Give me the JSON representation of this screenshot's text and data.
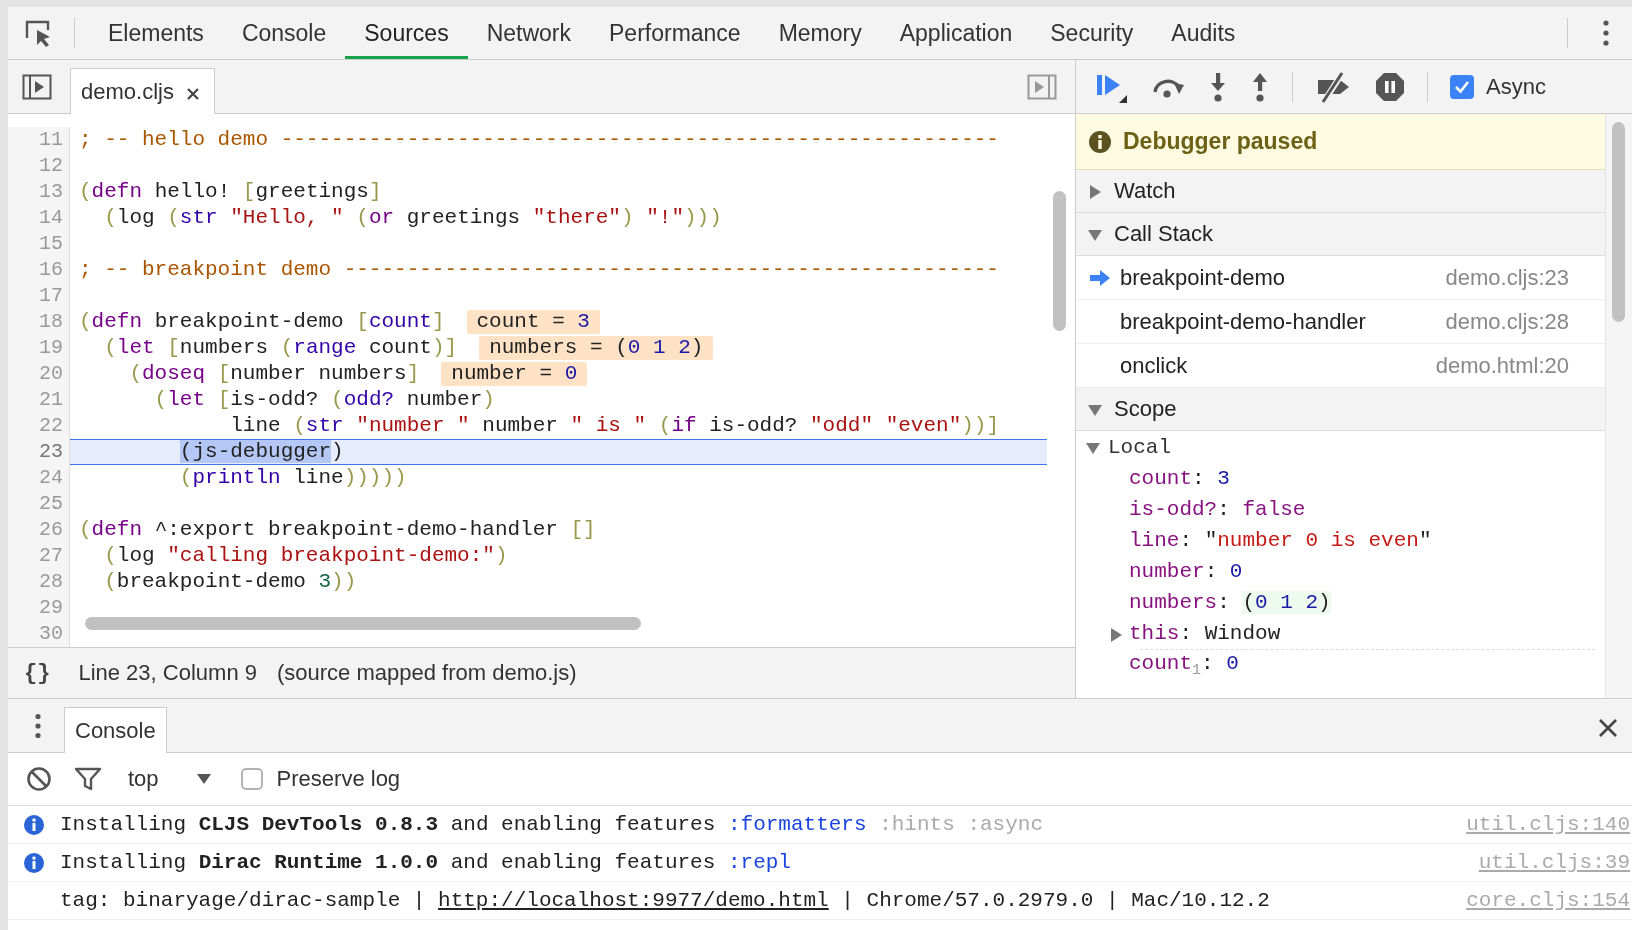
{
  "tabs": [
    {
      "label": "Elements",
      "selected": false
    },
    {
      "label": "Console",
      "selected": false
    },
    {
      "label": "Sources",
      "selected": true
    },
    {
      "label": "Network",
      "selected": false
    },
    {
      "label": "Performance",
      "selected": false
    },
    {
      "label": "Memory",
      "selected": false
    },
    {
      "label": "Application",
      "selected": false
    },
    {
      "label": "Security",
      "selected": false
    },
    {
      "label": "Audits",
      "selected": false
    }
  ],
  "editor": {
    "file_tab": {
      "label": "demo.cljs",
      "selected": true
    },
    "lines": [
      {
        "number": "11",
        "current": false,
        "code": [
          {
            "kind": "comment",
            "text": "; -- hello demo ---------------------------------------------------------"
          }
        ]
      },
      {
        "number": "12",
        "current": false
      },
      {
        "number": "13",
        "current": false,
        "code": [
          {
            "kind": "paren",
            "text": "("
          },
          {
            "kind": "keyword",
            "text": "defn"
          },
          {
            "kind": "plain",
            "text": " hello! "
          },
          {
            "kind": "paren",
            "text": "["
          },
          {
            "kind": "plain",
            "text": "greetings"
          },
          {
            "kind": "paren",
            "text": "]"
          }
        ]
      },
      {
        "number": "14",
        "current": false,
        "code": [
          {
            "kind": "paren",
            "text": "  ("
          },
          {
            "kind": "plain",
            "text": "log "
          },
          {
            "kind": "paren",
            "text": "("
          },
          {
            "kind": "builtin",
            "text": "str"
          },
          {
            "kind": "string",
            "text": " \"Hello, \""
          },
          {
            "kind": "paren",
            "text": " ("
          },
          {
            "kind": "keyword",
            "text": "or"
          },
          {
            "kind": "plain",
            "text": " greetings "
          },
          {
            "kind": "string",
            "text": "\"there\""
          },
          {
            "kind": "paren",
            "text": ")"
          },
          {
            "kind": "string",
            "text": " \"!\""
          },
          {
            "kind": "paren",
            "text": ")))"
          }
        ]
      },
      {
        "number": "15",
        "current": false
      },
      {
        "number": "16",
        "current": false,
        "code": [
          {
            "kind": "comment",
            "text": "; -- breakpoint demo ----------------------------------------------------"
          }
        ]
      },
      {
        "number": "17",
        "current": false
      },
      {
        "number": "18",
        "current": false,
        "code": [
          {
            "kind": "paren",
            "text": "("
          },
          {
            "kind": "keyword",
            "text": "defn"
          },
          {
            "kind": "plain",
            "text": " breakpoint-demo "
          },
          {
            "kind": "paren",
            "text": "["
          },
          {
            "kind": "builtin",
            "text": "count"
          },
          {
            "kind": "paren",
            "text": "]"
          }
        ],
        "inline_value": [
          {
            "kind": "plain",
            "text": "count = "
          },
          {
            "kind": "value",
            "text": "3"
          }
        ]
      },
      {
        "number": "19",
        "current": false,
        "code": [
          {
            "kind": "paren",
            "text": "  ("
          },
          {
            "kind": "keyword",
            "text": "let"
          },
          {
            "kind": "paren",
            "text": " ["
          },
          {
            "kind": "plain",
            "text": "numbers "
          },
          {
            "kind": "paren",
            "text": "("
          },
          {
            "kind": "builtin",
            "text": "range"
          },
          {
            "kind": "plain",
            "text": " count"
          },
          {
            "kind": "paren",
            "text": ")]"
          }
        ],
        "inline_value": [
          {
            "kind": "plain",
            "text": "numbers = ("
          },
          {
            "kind": "value",
            "text": "0 1 2"
          },
          {
            "kind": "plain",
            "text": ")"
          }
        ]
      },
      {
        "number": "20",
        "current": false,
        "code": [
          {
            "kind": "paren",
            "text": "    ("
          },
          {
            "kind": "keyword",
            "text": "doseq"
          },
          {
            "kind": "paren",
            "text": " ["
          },
          {
            "kind": "plain",
            "text": "number numbers"
          },
          {
            "kind": "paren",
            "text": "]"
          }
        ],
        "inline_value": [
          {
            "kind": "plain",
            "text": "number = "
          },
          {
            "kind": "value",
            "text": "0"
          }
        ]
      },
      {
        "number": "21",
        "current": false,
        "code": [
          {
            "kind": "paren",
            "text": "      ("
          },
          {
            "kind": "keyword",
            "text": "let"
          },
          {
            "kind": "paren",
            "text": " ["
          },
          {
            "kind": "plain",
            "text": "is-odd? "
          },
          {
            "kind": "paren",
            "text": "("
          },
          {
            "kind": "builtin",
            "text": "odd?"
          },
          {
            "kind": "plain",
            "text": " number"
          },
          {
            "kind": "paren",
            "text": ")"
          }
        ]
      },
      {
        "number": "22",
        "current": false,
        "code": [
          {
            "kind": "plain",
            "text": "            line "
          },
          {
            "kind": "paren",
            "text": "("
          },
          {
            "kind": "builtin",
            "text": "str"
          },
          {
            "kind": "string",
            "text": " \"number \""
          },
          {
            "kind": "plain",
            "text": " number "
          },
          {
            "kind": "string",
            "text": "\" is \""
          },
          {
            "kind": "paren",
            "text": " ("
          },
          {
            "kind": "keyword",
            "text": "if"
          },
          {
            "kind": "plain",
            "text": " is-odd? "
          },
          {
            "kind": "string",
            "text": "\"odd\""
          },
          {
            "kind": "string",
            "text": " \"even\""
          },
          {
            "kind": "paren",
            "text": "))]"
          }
        ]
      },
      {
        "number": "23",
        "current": true,
        "code": [
          {
            "kind": "selection",
            "text": "        (js-debugger"
          },
          {
            "kind": "plain",
            "text": ")"
          }
        ]
      },
      {
        "number": "24",
        "current": false,
        "code": [
          {
            "kind": "paren",
            "text": "        ("
          },
          {
            "kind": "builtin",
            "text": "println"
          },
          {
            "kind": "plain",
            "text": " line"
          },
          {
            "kind": "paren",
            "text": ")))))"
          }
        ]
      },
      {
        "number": "25",
        "current": false
      },
      {
        "number": "26",
        "current": false,
        "code": [
          {
            "kind": "paren",
            "text": "("
          },
          {
            "kind": "keyword",
            "text": "defn"
          },
          {
            "kind": "plain",
            "text": " ^:export breakpoint-demo-handler "
          },
          {
            "kind": "paren",
            "text": "[]"
          }
        ]
      },
      {
        "number": "27",
        "current": false,
        "code": [
          {
            "kind": "paren",
            "text": "  ("
          },
          {
            "kind": "plain",
            "text": "log "
          },
          {
            "kind": "string",
            "text": "\"calling breakpoint-demo:\""
          },
          {
            "kind": "paren",
            "text": ")"
          }
        ]
      },
      {
        "number": "28",
        "current": false,
        "code": [
          {
            "kind": "paren",
            "text": "  ("
          },
          {
            "kind": "plain",
            "text": "breakpoint-demo "
          },
          {
            "kind": "number",
            "text": "3"
          },
          {
            "kind": "paren",
            "text": "))"
          }
        ]
      },
      {
        "number": "29",
        "current": false
      },
      {
        "number": "30",
        "current": false
      }
    ]
  },
  "status_bar": {
    "format_button": "{}",
    "position": "Line 23, Column 9",
    "source_map": "(source mapped from demo.js)"
  },
  "debugger": {
    "async": {
      "label": "Async",
      "checked": true
    },
    "banner": "Debugger paused",
    "watch": {
      "label": "Watch",
      "expanded": false
    },
    "call_stack": {
      "label": "Call Stack",
      "expanded": true,
      "frames": [
        {
          "name": "breakpoint-demo",
          "location": "demo.cljs:23",
          "selected": true
        },
        {
          "name": "breakpoint-demo-handler",
          "location": "demo.cljs:28",
          "selected": false
        },
        {
          "name": "onclick",
          "location": "demo.html:20",
          "selected": false
        }
      ]
    },
    "scope": {
      "label": "Scope",
      "expanded": true,
      "local": {
        "label": "Local",
        "expanded": true,
        "groups": [
          [
            {
              "expandable": false,
              "segments": [
                {
                  "kind": "name",
                  "text": "count"
                },
                {
                  "kind": "punct",
                  "text": ": "
                },
                {
                  "kind": "number",
                  "text": "3"
                }
              ]
            },
            {
              "expandable": false,
              "segments": [
                {
                  "kind": "name",
                  "text": "is-odd?"
                },
                {
                  "kind": "punct",
                  "text": ": "
                },
                {
                  "kind": "boolean",
                  "text": "false"
                }
              ]
            },
            {
              "expandable": false,
              "segments": [
                {
                  "kind": "name",
                  "text": "line"
                },
                {
                  "kind": "punct",
                  "text": ": \""
                },
                {
                  "kind": "string",
                  "text": "number 0 is even"
                },
                {
                  "kind": "punct",
                  "text": "\""
                }
              ]
            },
            {
              "expandable": false,
              "segments": [
                {
                  "kind": "name",
                  "text": "number"
                },
                {
                  "kind": "punct",
                  "text": ": "
                },
                {
                  "kind": "number",
                  "text": "0"
                }
              ]
            },
            {
              "expandable": false,
              "segments": [
                {
                  "kind": "name",
                  "text": "numbers"
                },
                {
                  "kind": "punct",
                  "text": ": "
                },
                {
                  "kind": "seq-punct",
                  "text": "("
                },
                {
                  "kind": "seq-number",
                  "text": "0 1 2"
                },
                {
                  "kind": "seq-punct",
                  "text": ")"
                }
              ]
            },
            {
              "expandable": true,
              "segments": [
                {
                  "kind": "name",
                  "text": "this"
                },
                {
                  "kind": "punct",
                  "text": ": Window"
                }
              ]
            }
          ],
          [
            {
              "expandable": false,
              "segments": [
                {
                  "kind": "name",
                  "text": "count$_{1}$"
                },
                {
                  "kind": "punct",
                  "text": ": "
                },
                {
                  "kind": "number",
                  "text": "0"
                }
              ]
            }
          ]
        ]
      }
    }
  },
  "drawer": {
    "tab": {
      "label": "Console",
      "selected": true
    },
    "context": "top",
    "preserve_log": {
      "label": "Preserve log",
      "checked": false
    },
    "messages": [
      {
        "kind": "info",
        "segments": [
          {
            "kind": "plain",
            "text": "Installing "
          },
          {
            "kind": "bold",
            "text": "CLJS DevTools 0.8.3"
          },
          {
            "kind": "plain",
            "text": " and enabling features "
          },
          {
            "kind": "keyword",
            "text": ":formatters"
          },
          {
            "kind": "dim",
            "text": " :hints :async"
          }
        ],
        "source": "util.cljs:140"
      },
      {
        "kind": "info",
        "segments": [
          {
            "kind": "plain",
            "text": "Installing "
          },
          {
            "kind": "bold",
            "text": "Dirac Runtime 1.0.0"
          },
          {
            "kind": "plain",
            "text": " and enabling features "
          },
          {
            "kind": "keyword",
            "text": ":repl"
          }
        ],
        "source": "util.cljs:39"
      },
      {
        "kind": "log",
        "segments": [
          {
            "kind": "plain",
            "text": "tag: binaryage/dirac-sample | "
          },
          {
            "kind": "link",
            "text": "http://localhost:9977/demo.html"
          },
          {
            "kind": "plain",
            "text": " | Chrome/57.0.2979.0 | Mac/10.12.2"
          }
        ],
        "source": "core.cljs:154"
      }
    ]
  }
}
